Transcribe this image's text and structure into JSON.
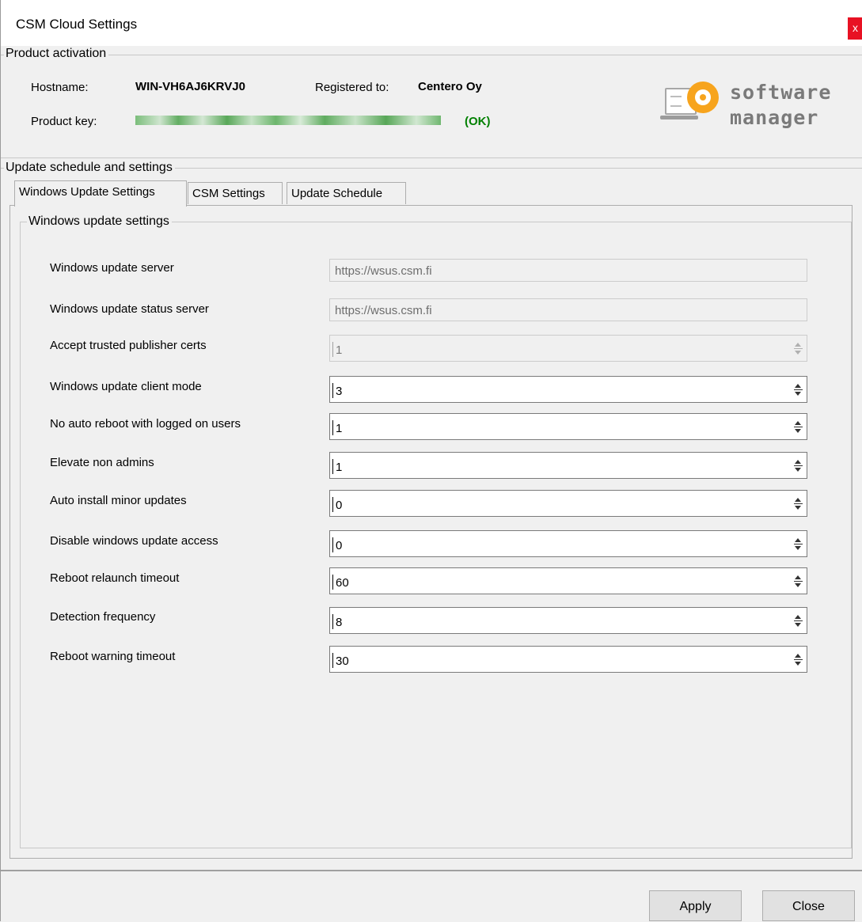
{
  "window": {
    "title": "CSM Cloud Settings",
    "close_glyph": "x"
  },
  "activation": {
    "legend": "Product activation",
    "hostname_label": "Hostname:",
    "hostname_value": "WIN-VH6AJ6KRVJ0",
    "registered_label": "Registered to:",
    "registered_value": "Centero Oy",
    "product_key_label": "Product key:",
    "product_key_status": "(OK)"
  },
  "logo": {
    "line1": "software",
    "line2": "manager",
    "accent_color": "#f7a41d"
  },
  "update": {
    "legend": "Update schedule and settings",
    "tabs": [
      {
        "label": "Windows Update Settings",
        "active": true
      },
      {
        "label": "CSM Settings",
        "active": false
      },
      {
        "label": "Update Schedule",
        "active": false
      }
    ],
    "panel_legend": "Windows update settings",
    "fields": [
      {
        "label": "Windows update server",
        "value": "https://wsus.csm.fi",
        "kind": "text",
        "enabled": false
      },
      {
        "label": "Windows update status server",
        "value": "https://wsus.csm.fi",
        "kind": "text",
        "enabled": false
      },
      {
        "label": "Accept trusted publisher certs",
        "value": "1",
        "kind": "spin",
        "enabled": false
      },
      {
        "label": "Windows update client mode",
        "value": "3",
        "kind": "spin",
        "enabled": true
      },
      {
        "label": "No auto reboot with logged on users",
        "value": "1",
        "kind": "spin",
        "enabled": true
      },
      {
        "label": "Elevate non admins",
        "value": "1",
        "kind": "spin",
        "enabled": true
      },
      {
        "label": "Auto install minor updates",
        "value": "0",
        "kind": "spin",
        "enabled": true
      },
      {
        "label": "Disable windows update access",
        "value": "0",
        "kind": "spin",
        "enabled": true
      },
      {
        "label": "Reboot relaunch timeout",
        "value": "60",
        "kind": "spin",
        "enabled": true
      },
      {
        "label": "Detection frequency",
        "value": "8",
        "kind": "spin",
        "enabled": true
      },
      {
        "label": "Reboot warning timeout",
        "value": "30",
        "kind": "spin",
        "enabled": true
      }
    ]
  },
  "buttons": {
    "apply": "Apply",
    "close": "Close"
  },
  "colors": {
    "ok_green": "#008000",
    "close_red": "#e81123"
  }
}
